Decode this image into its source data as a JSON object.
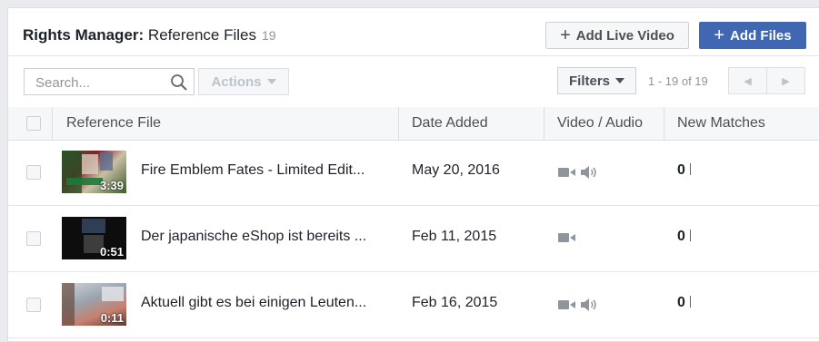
{
  "header": {
    "title_bold": "Rights Manager:",
    "title_rest": "Reference Files",
    "count": "19",
    "add_live_label": "Add Live Video",
    "add_files_label": "Add Files",
    "plus_glyph": "+"
  },
  "toolbar": {
    "search_placeholder": "Search...",
    "actions_label": "Actions",
    "filters_label": "Filters",
    "range_text": "1 - 19 of 19",
    "prev_glyph": "◀",
    "next_glyph": "▶"
  },
  "table": {
    "columns": [
      "Reference File",
      "Date Added",
      "Video / Audio",
      "New Matches"
    ],
    "rows": [
      {
        "title": "Fire Emblem Fates - Limited Edit...",
        "date": "May 20, 2016",
        "duration": "3:39",
        "has_audio": true,
        "matches": "0"
      },
      {
        "title": "Der japanische eShop ist bereits ...",
        "date": "Feb 11, 2015",
        "duration": "0:51",
        "has_audio": false,
        "matches": "0"
      },
      {
        "title": "Aktuell gibt es bei einigen Leuten...",
        "date": "Feb 16, 2015",
        "duration": "0:11",
        "has_audio": true,
        "matches": "0"
      }
    ]
  },
  "icons": {
    "search": "search-icon",
    "video": "video-camera-icon",
    "audio": "speaker-icon"
  },
  "colors": {
    "primary_button": "#4267b2",
    "background": "#e9ebee",
    "panel_border": "#dddfe2",
    "muted_text": "#90949c"
  }
}
